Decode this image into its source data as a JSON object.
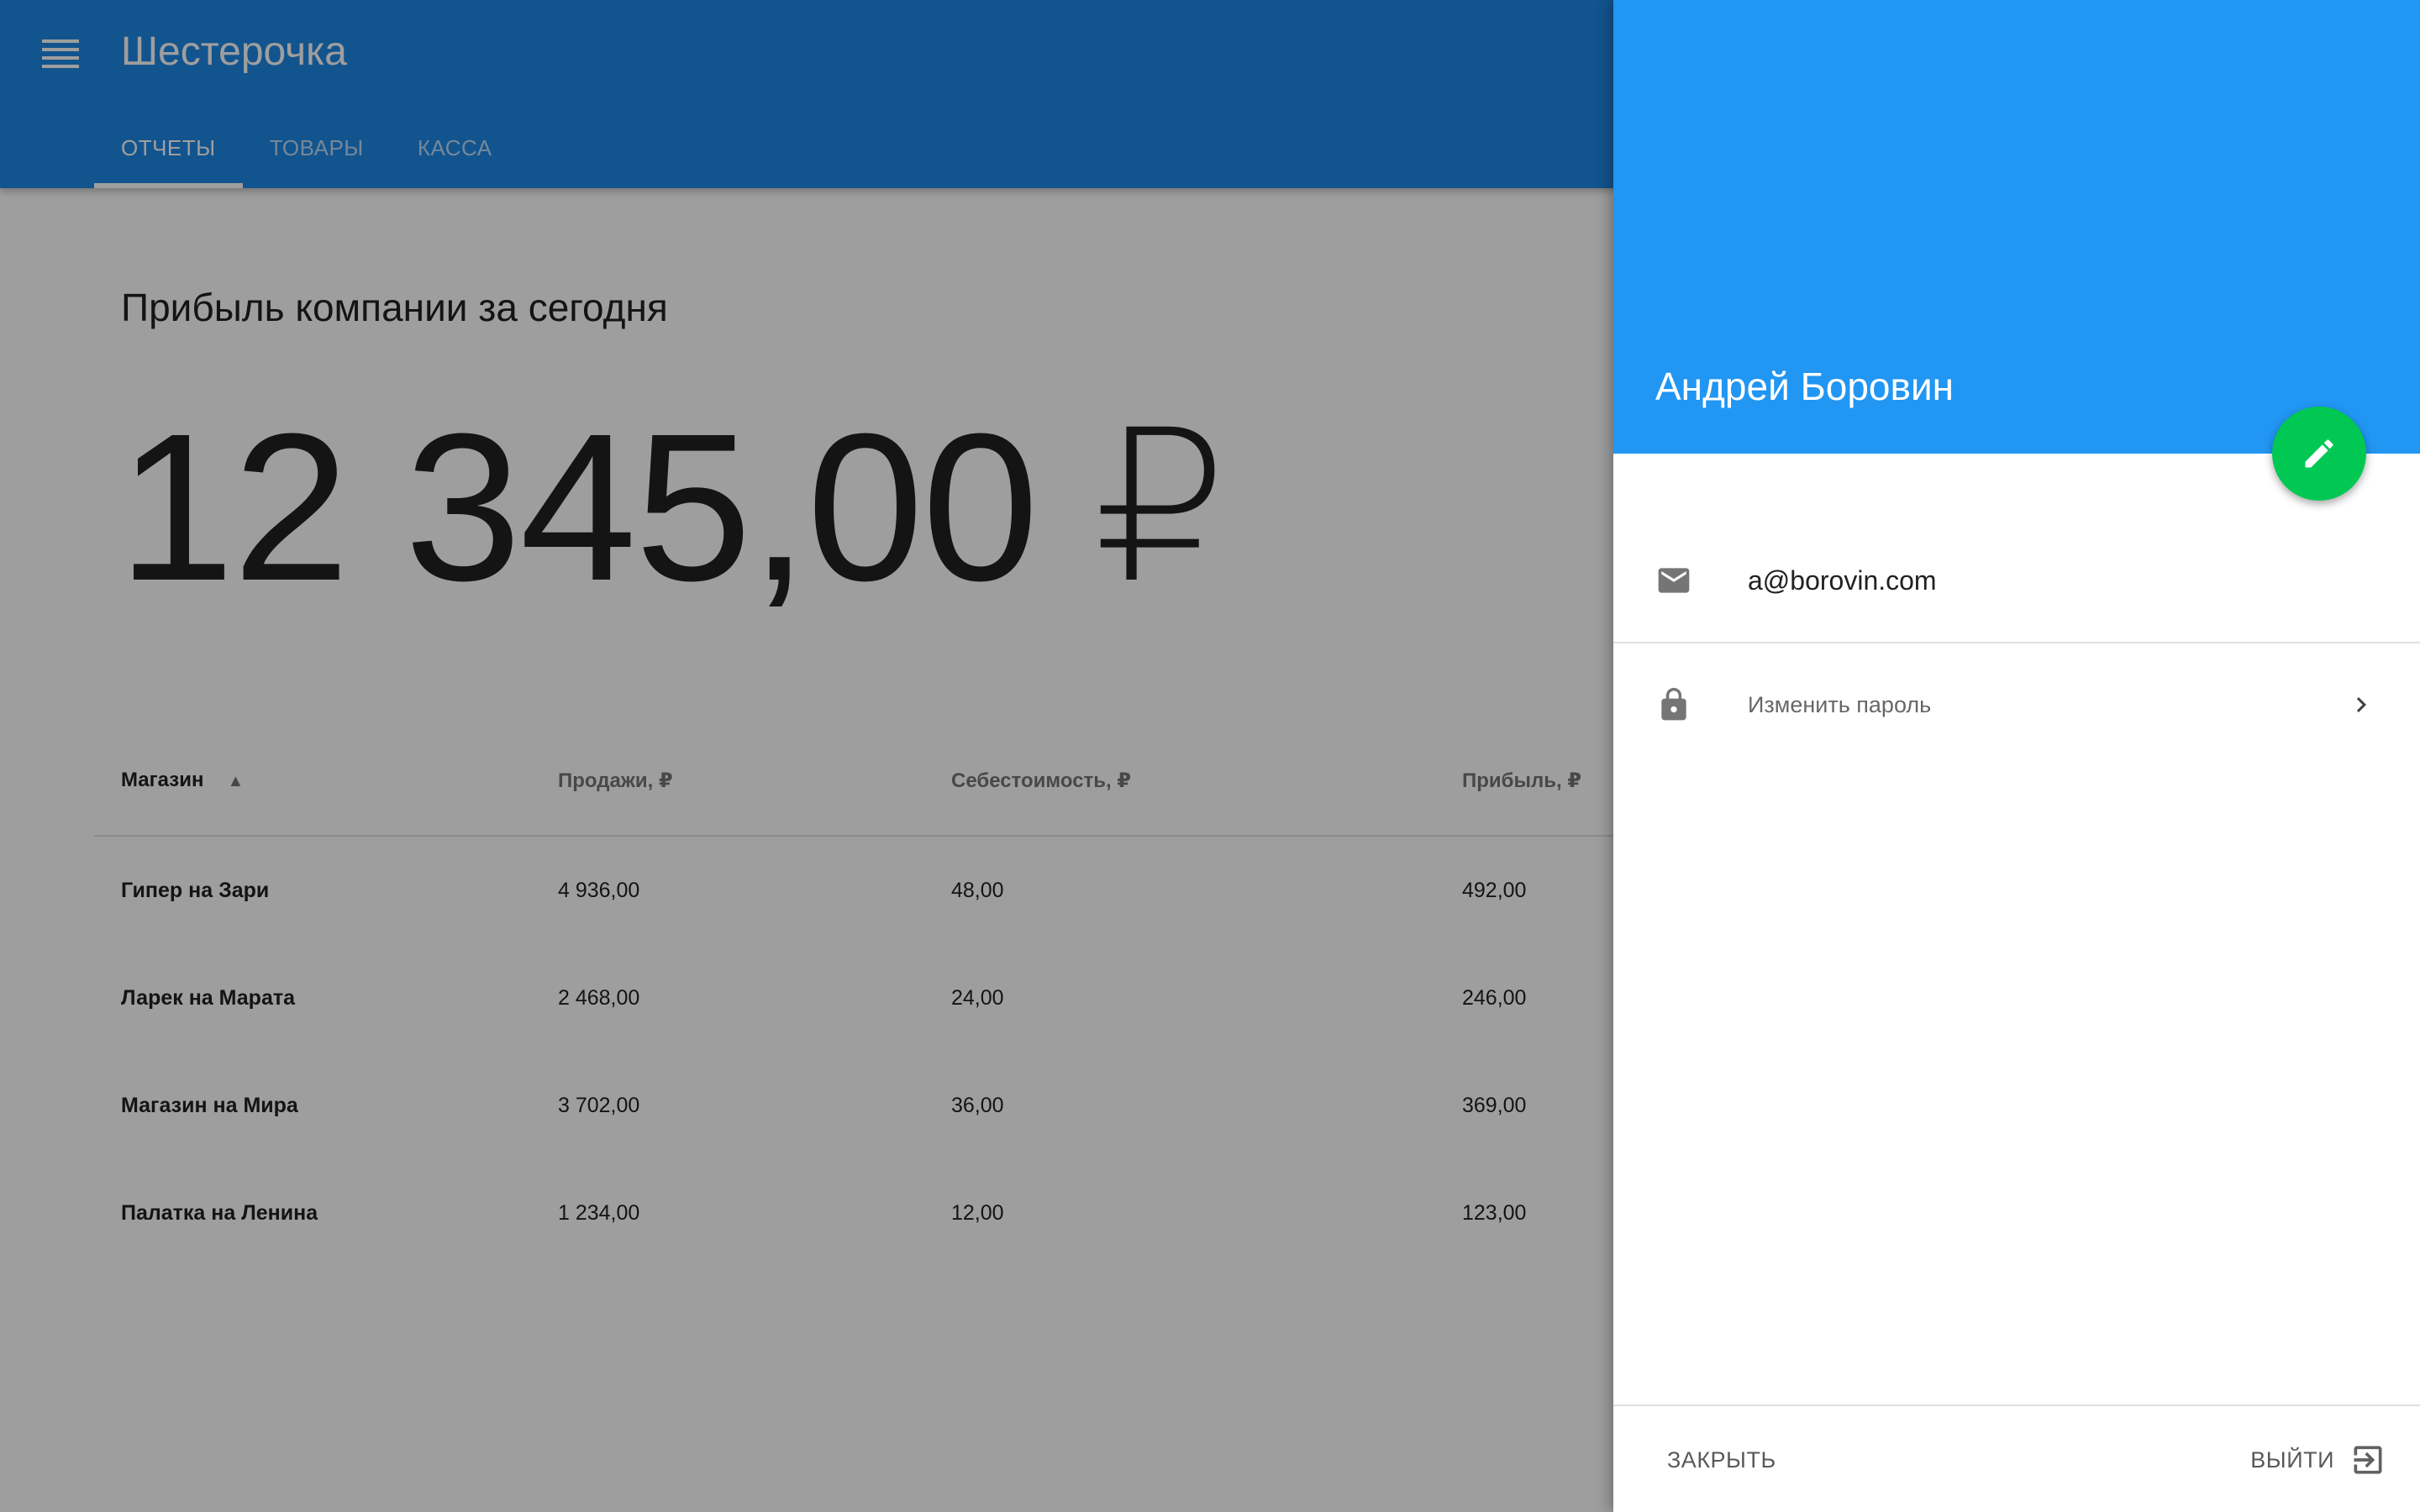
{
  "app": {
    "title": "Шестерочка",
    "tabs": [
      {
        "label": "ОТЧЕТЫ",
        "active": true
      },
      {
        "label": "ТОВАРЫ",
        "active": false
      },
      {
        "label": "КАССА",
        "active": false
      }
    ]
  },
  "report": {
    "profit_label": "Прибыль компании за сегодня",
    "profit_value": "12 345,00 ₽",
    "columns": [
      "Магазин",
      "Продажи, ₽",
      "Себестоимость, ₽",
      "Прибыль, ₽"
    ],
    "sort_indicator": "▲",
    "rows": [
      {
        "store": "Гипер на Зари",
        "sales": "4 936,00",
        "cost": "48,00",
        "profit": "492,00"
      },
      {
        "store": "Ларек на Марата",
        "sales": "2 468,00",
        "cost": "24,00",
        "profit": "246,00"
      },
      {
        "store": "Магазин на Мира",
        "sales": "3 702,00",
        "cost": "36,00",
        "profit": "369,00"
      },
      {
        "store": "Палатка на Ленина",
        "sales": "1 234,00",
        "cost": "12,00",
        "profit": "123,00"
      }
    ]
  },
  "drawer": {
    "user_name": "Андрей Боровин",
    "email": "a@borovin.com",
    "change_password": "Изменить пароль",
    "close_label": "ЗАКРЫТЬ",
    "logout_label": "ВЫЙТИ",
    "icons": {
      "fab": "pencil-icon",
      "email": "email-icon",
      "password": "lock-icon",
      "chevron": "chevron-right-icon",
      "logout": "logout-icon"
    }
  },
  "colors": {
    "appbar": "#1e88e5",
    "drawer_header": "#2196f3",
    "fab": "#00c853"
  }
}
